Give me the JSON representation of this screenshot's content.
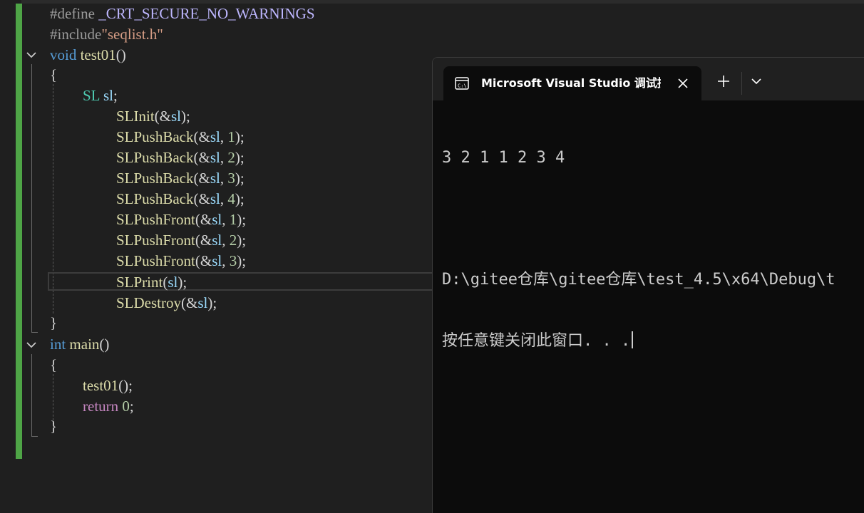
{
  "editor": {
    "lines": [
      [
        {
          "t": "#define ",
          "c": "pp"
        },
        {
          "t": "_CRT_SECURE_NO_WARNINGS",
          "c": "macro"
        }
      ],
      [
        {
          "t": "#include",
          "c": "pp"
        },
        {
          "t": "\"seqlist.h\"",
          "c": "str"
        }
      ],
      [
        {
          "t": "void ",
          "c": "kw"
        },
        {
          "t": "test01",
          "c": "fn"
        },
        {
          "t": "()",
          "c": "punc"
        }
      ],
      [
        {
          "t": "{",
          "c": "punc"
        }
      ],
      [
        {
          "t": "SL ",
          "c": "ty"
        },
        {
          "t": "sl",
          "c": "var"
        },
        {
          "t": ";",
          "c": "punc"
        }
      ],
      [
        {
          "t": "SLInit",
          "c": "fn"
        },
        {
          "t": "(&",
          "c": "punc"
        },
        {
          "t": "sl",
          "c": "var"
        },
        {
          "t": ");",
          "c": "punc"
        }
      ],
      [
        {
          "t": "SLPushBack",
          "c": "fn"
        },
        {
          "t": "(&",
          "c": "punc"
        },
        {
          "t": "sl",
          "c": "var"
        },
        {
          "t": ", ",
          "c": "punc"
        },
        {
          "t": "1",
          "c": "num"
        },
        {
          "t": ");",
          "c": "punc"
        }
      ],
      [
        {
          "t": "SLPushBack",
          "c": "fn"
        },
        {
          "t": "(&",
          "c": "punc"
        },
        {
          "t": "sl",
          "c": "var"
        },
        {
          "t": ", ",
          "c": "punc"
        },
        {
          "t": "2",
          "c": "num"
        },
        {
          "t": ");",
          "c": "punc"
        }
      ],
      [
        {
          "t": "SLPushBack",
          "c": "fn"
        },
        {
          "t": "(&",
          "c": "punc"
        },
        {
          "t": "sl",
          "c": "var"
        },
        {
          "t": ", ",
          "c": "punc"
        },
        {
          "t": "3",
          "c": "num"
        },
        {
          "t": ");",
          "c": "punc"
        }
      ],
      [
        {
          "t": "SLPushBack",
          "c": "fn"
        },
        {
          "t": "(&",
          "c": "punc"
        },
        {
          "t": "sl",
          "c": "var"
        },
        {
          "t": ", ",
          "c": "punc"
        },
        {
          "t": "4",
          "c": "num"
        },
        {
          "t": ");",
          "c": "punc"
        }
      ],
      [
        {
          "t": "SLPushFront",
          "c": "fn"
        },
        {
          "t": "(&",
          "c": "punc"
        },
        {
          "t": "sl",
          "c": "var"
        },
        {
          "t": ", ",
          "c": "punc"
        },
        {
          "t": "1",
          "c": "num"
        },
        {
          "t": ");",
          "c": "punc"
        }
      ],
      [
        {
          "t": "SLPushFront",
          "c": "fn"
        },
        {
          "t": "(&",
          "c": "punc"
        },
        {
          "t": "sl",
          "c": "var"
        },
        {
          "t": ", ",
          "c": "punc"
        },
        {
          "t": "2",
          "c": "num"
        },
        {
          "t": ");",
          "c": "punc"
        }
      ],
      [
        {
          "t": "SLPushFront",
          "c": "fn"
        },
        {
          "t": "(&",
          "c": "punc"
        },
        {
          "t": "sl",
          "c": "var"
        },
        {
          "t": ", ",
          "c": "punc"
        },
        {
          "t": "3",
          "c": "num"
        },
        {
          "t": ");",
          "c": "punc"
        }
      ],
      [
        {
          "t": "SLPrint",
          "c": "fn"
        },
        {
          "t": "(",
          "c": "punc"
        },
        {
          "t": "sl",
          "c": "var"
        },
        {
          "t": ");",
          "c": "punc"
        }
      ],
      [
        {
          "t": "SLDestroy",
          "c": "fn"
        },
        {
          "t": "(&",
          "c": "punc"
        },
        {
          "t": "sl",
          "c": "var"
        },
        {
          "t": ");",
          "c": "punc"
        }
      ],
      [
        {
          "t": "}",
          "c": "punc"
        }
      ],
      [
        {
          "t": "int ",
          "c": "kw"
        },
        {
          "t": "main",
          "c": "fn"
        },
        {
          "t": "()",
          "c": "punc"
        }
      ],
      [
        {
          "t": "{",
          "c": "punc"
        }
      ],
      [
        {
          "t": "test01",
          "c": "fn"
        },
        {
          "t": "();",
          "c": "punc"
        }
      ],
      [
        {
          "t": "return ",
          "c": "kw2"
        },
        {
          "t": "0",
          "c": "num"
        },
        {
          "t": ";",
          "c": "punc"
        }
      ],
      [
        {
          "t": "}",
          "c": "punc"
        }
      ]
    ]
  },
  "terminal": {
    "tab_title": "Microsoft Visual Studio 调试控",
    "output_lines": [
      "3 2 1 1 2 3 4",
      "",
      "D:\\gitee仓库\\gitee仓库\\test_4.5\\x64\\Debug\\t",
      "按任意键关闭此窗口. . ."
    ]
  },
  "colors": {
    "editor_bg": "#1f1f1f",
    "change_bar": "#4ea446",
    "terminal_bg": "#0c0c0c",
    "tab_strip_bg": "#202020"
  }
}
